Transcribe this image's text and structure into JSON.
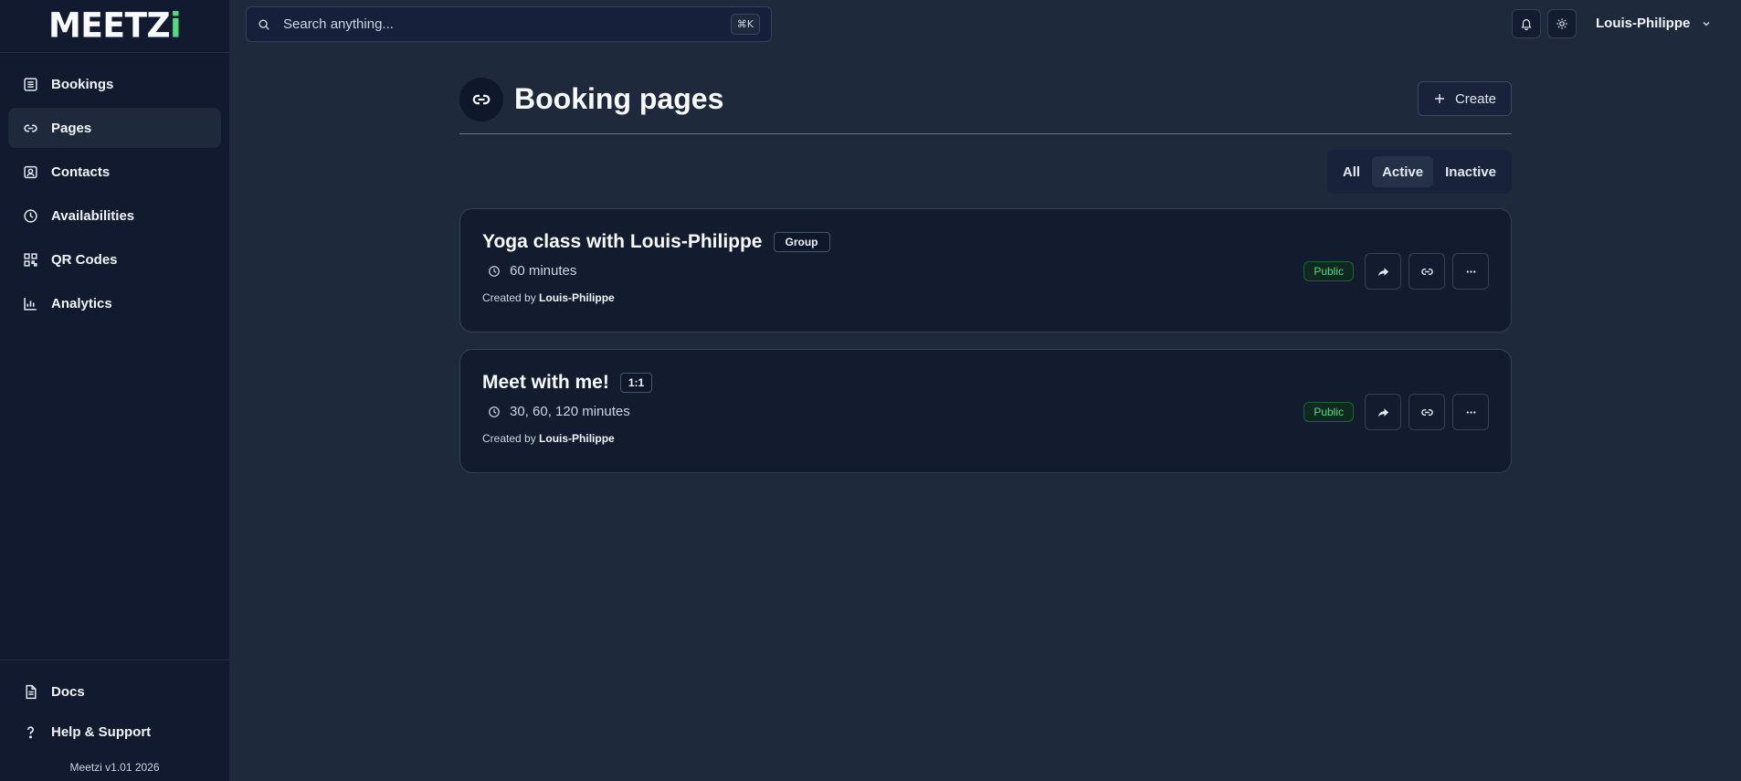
{
  "app": {
    "logo": {
      "main": "MEETZ",
      "accent": "i"
    },
    "version": "Meetzi v1.01 2026"
  },
  "sidebar": {
    "items": [
      {
        "label": "Bookings",
        "icon": "list-icon"
      },
      {
        "label": "Pages",
        "icon": "link-icon",
        "active": true
      },
      {
        "label": "Contacts",
        "icon": "contact-card-icon"
      },
      {
        "label": "Availabilities",
        "icon": "clock-icon"
      },
      {
        "label": "QR Codes",
        "icon": "qr-code-icon"
      },
      {
        "label": "Analytics",
        "icon": "bar-chart-icon"
      }
    ],
    "bottom_items": [
      {
        "label": "Docs",
        "icon": "document-icon"
      },
      {
        "label": "Help & Support",
        "icon": "question-mark-icon"
      }
    ]
  },
  "topbar": {
    "search": {
      "placeholder": "Search anything...",
      "shortcut": "⌘K"
    },
    "user_name": "Louis-Philippe"
  },
  "page": {
    "title": "Booking pages",
    "create_label": "Create",
    "filters": [
      {
        "label": "All",
        "active": false
      },
      {
        "label": "Active",
        "active": true
      },
      {
        "label": "Inactive",
        "active": false
      }
    ]
  },
  "cards": [
    {
      "title": "Yoga class with Louis-Philippe",
      "type": "Group",
      "duration": "60 minutes",
      "created_prefix": "Created by",
      "created_by": "Louis-Philippe",
      "visibility": "Public"
    },
    {
      "title": "Meet with me!",
      "type": "1:1",
      "duration": "30, 60, 120 minutes",
      "created_prefix": "Created by",
      "created_by": "Louis-Philippe",
      "visibility": "Public"
    }
  ],
  "colors": {
    "background": "#1e293b",
    "sidebar": "#111a2e",
    "accent": "#4ade80",
    "card": "#131c2f"
  }
}
